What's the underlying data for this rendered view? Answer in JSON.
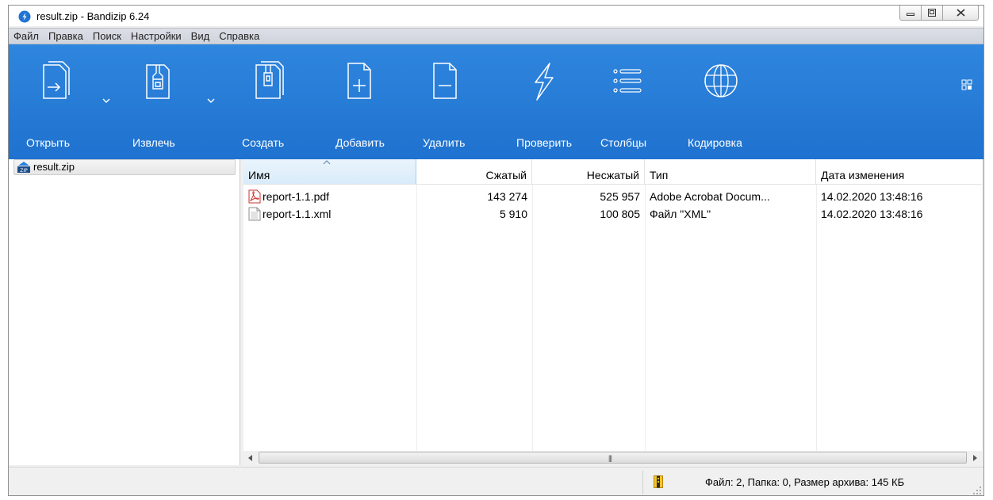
{
  "window": {
    "title": "result.zip - Bandizip 6.24"
  },
  "menu": [
    "Файл",
    "Правка",
    "Поиск",
    "Настройки",
    "Вид",
    "Справка"
  ],
  "toolbar": {
    "open": "Открыть",
    "extract": "Извлечь",
    "create": "Создать",
    "add": "Добавить",
    "delete": "Удалить",
    "test": "Проверить",
    "columns": "Столбцы",
    "encoding": "Кодировка"
  },
  "tree": {
    "root": "result.zip"
  },
  "columns": {
    "name": "Имя",
    "packed": "Сжатый",
    "size": "Несжатый",
    "type": "Тип",
    "modified": "Дата изменения"
  },
  "files": [
    {
      "name": "report-1.1.pdf",
      "packed": "143 274",
      "size": "525 957",
      "type": "Adobe Acrobat Docum...",
      "modified": "14.02.2020 13:48:16",
      "icon": "pdf-file-icon"
    },
    {
      "name": "report-1.1.xml",
      "packed": "5 910",
      "size": "100 805",
      "type": "Файл \"XML\"",
      "modified": "14.02.2020 13:48:16",
      "icon": "xml-file-icon"
    }
  ],
  "status": {
    "summary": "Файл: 2, Папка: 0, Размер архива: 145 КБ"
  },
  "colors": {
    "toolbar": "#2a7fdc",
    "selection": "#d9ebf9"
  }
}
